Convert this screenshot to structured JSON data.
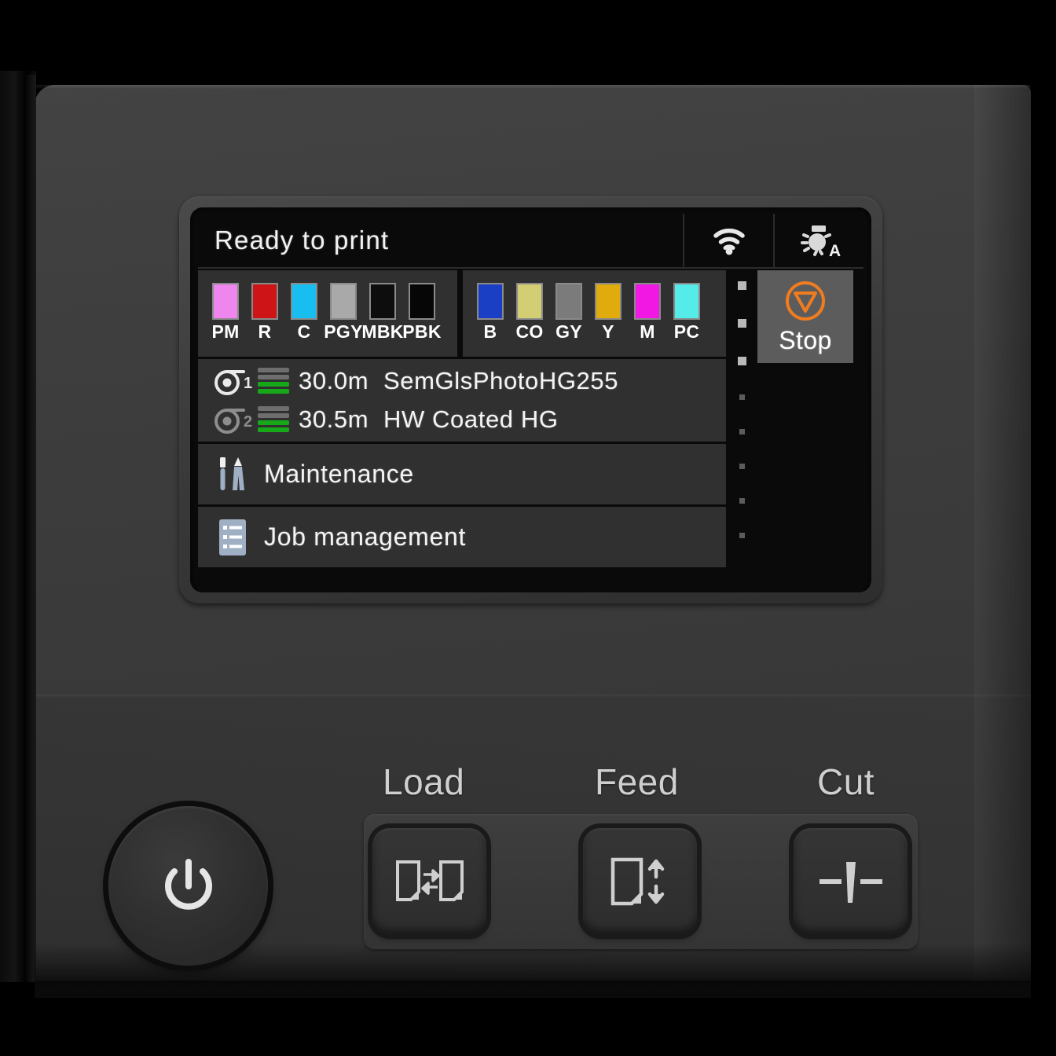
{
  "device": {
    "name": "large-format-printer-control-panel"
  },
  "screen": {
    "status": {
      "message": "Ready to print",
      "wifi_icon": "wifi-icon",
      "lamp_icon": "lamp-auto-icon"
    },
    "ink": {
      "group_left": [
        {
          "code": "PM",
          "color": "#ee86ee"
        },
        {
          "code": "R",
          "color": "#cf1417"
        },
        {
          "code": "C",
          "color": "#18bef0"
        },
        {
          "code": "PGY",
          "color": "#a9a9a9"
        },
        {
          "code": "MBK",
          "color": "#0d0d0d"
        },
        {
          "code": "PBK",
          "color": "#060606"
        }
      ],
      "group_right": [
        {
          "code": "B",
          "color": "#1b3fc4"
        },
        {
          "code": "CO",
          "color": "#d3cd74"
        },
        {
          "code": "GY",
          "color": "#7b7b7b"
        },
        {
          "code": "Y",
          "color": "#e0ab0d"
        },
        {
          "code": "M",
          "color": "#f118e4"
        },
        {
          "code": "PC",
          "color": "#55ebe9"
        }
      ]
    },
    "rolls": [
      {
        "number": "1",
        "length": "30.0m",
        "media": "SemGlsPhotoHG255",
        "level_bars": [
          "#6e6e6e",
          "#6e6e6e",
          "#17a81a",
          "#17a81a"
        ],
        "active": true
      },
      {
        "number": "2",
        "length": "30.5m",
        "media": "HW Coated HG",
        "level_bars": [
          "#6e6e6e",
          "#6e6e6e",
          "#17a81a",
          "#17a81a"
        ],
        "active": false
      }
    ],
    "menu": [
      {
        "label": "Maintenance",
        "icon": "tools-icon"
      },
      {
        "label": "Job management",
        "icon": "list-icon"
      }
    ],
    "scroll_dots": [
      true,
      true,
      true,
      false,
      false,
      false,
      false,
      false
    ],
    "stop": {
      "label": "Stop",
      "icon": "stop-triangle-icon",
      "accent": "#f07c20",
      "background": "#5c5c5c"
    }
  },
  "hardware": {
    "power_button": {
      "icon": "power-icon"
    },
    "keys": [
      {
        "label": "Load",
        "icon": "load-paper-icon"
      },
      {
        "label": "Feed",
        "icon": "feed-paper-icon"
      },
      {
        "label": "Cut",
        "icon": "cutter-blade-icon"
      }
    ]
  }
}
